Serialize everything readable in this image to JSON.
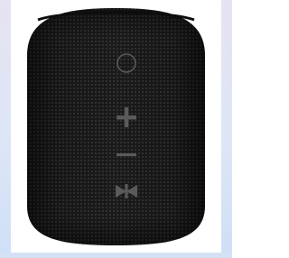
{
  "image": {
    "subject": "speaker-product-photo",
    "colors": {
      "background": "#ffffff",
      "body": "#1b1b1b",
      "mesh_dot": "#3a3a3a",
      "button_mark": "#5a5a5a",
      "frame_tint": "#dde6f6"
    },
    "controls": [
      {
        "icon": "power-icon"
      },
      {
        "icon": "plus-icon"
      },
      {
        "icon": "minus-icon"
      },
      {
        "icon": "play-pause-icon"
      }
    ]
  }
}
